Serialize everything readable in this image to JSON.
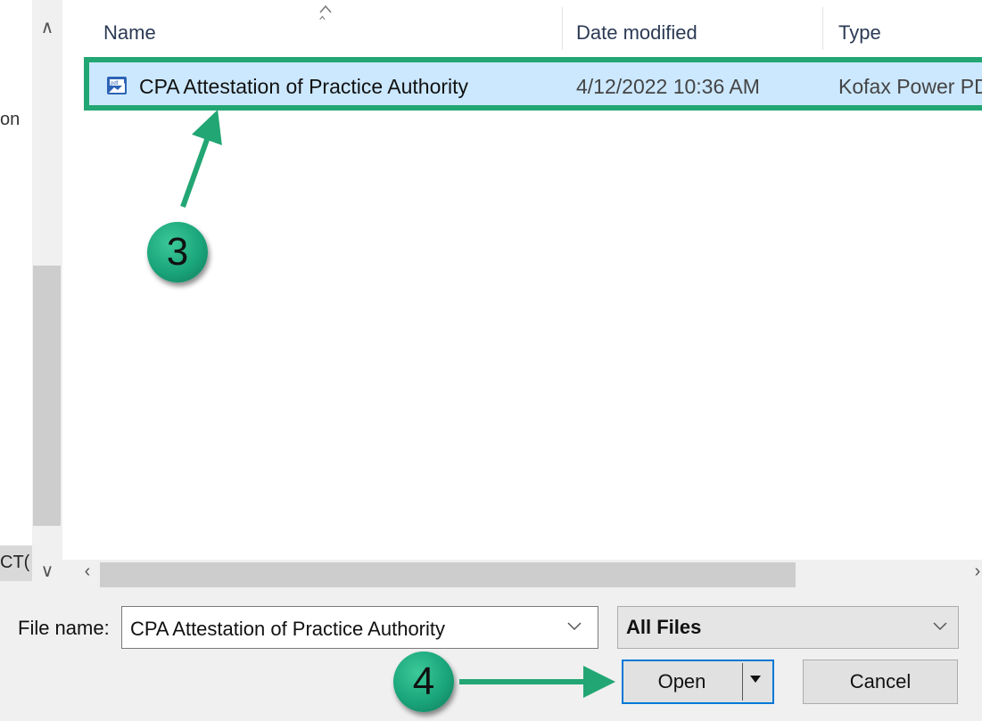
{
  "nav_pane": {
    "clipped_label_top": "on",
    "clipped_label_bottom": "CT("
  },
  "file_list": {
    "columns": [
      "Name",
      "Date modified",
      "Type"
    ],
    "rows": [
      {
        "name": "CPA Attestation of Practice Authority",
        "date_modified": "4/12/2022 10:36 AM",
        "type": "Kofax Power PD",
        "icon": "pdf-file-icon",
        "selected": true
      }
    ]
  },
  "annotations": {
    "step_3": "3",
    "step_4": "4",
    "highlight_color": "#22a673"
  },
  "bottom_bar": {
    "file_name_label": "File name:",
    "file_name_value": "CPA Attestation of Practice Authority",
    "file_type_value": "All Files",
    "open_label": "Open",
    "cancel_label": "Cancel"
  },
  "colors": {
    "selection_bg": "#cce8ff",
    "accent_blue": "#0078d7",
    "callout_green": "#1aa57a"
  }
}
